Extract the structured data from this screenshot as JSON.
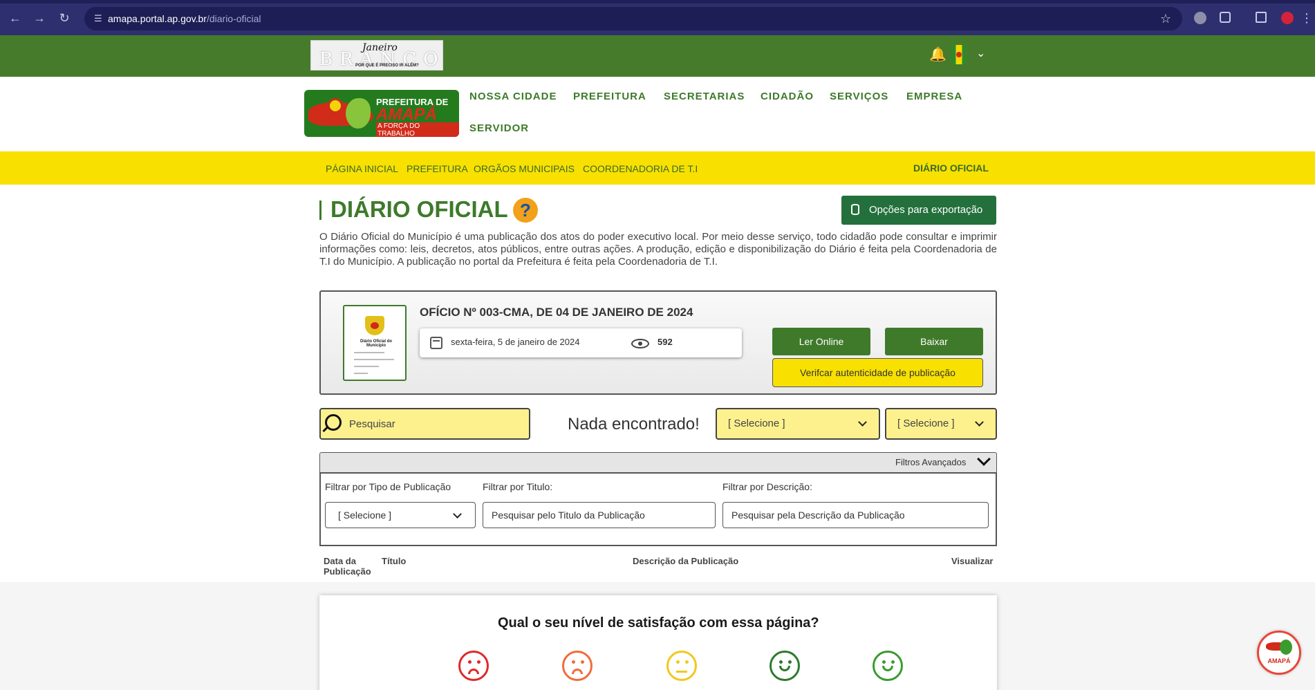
{
  "browser": {
    "url_host": "amapa.portal.ap.gov.br",
    "url_path": "/diario-oficial"
  },
  "brand": {
    "word": "BRANCO",
    "signature": "Janeiro",
    "tagline": "POR QUE É PRECISO IR ALÉM?"
  },
  "city_logo": {
    "line1": "PREFEITURA DE",
    "line2": "AMAPÁ",
    "line3": "A FORÇA DO TRABALHO"
  },
  "main_menu": [
    "NOSSA CIDADE",
    "PREFEITURA",
    "SECRETARIAS",
    "CIDADÃO",
    "SERVIÇOS",
    "EMPRESA",
    "SERVIDOR"
  ],
  "breadcrumb": {
    "items": [
      "PÁGINA INICIAL",
      "PREFEITURA",
      "ORGÃOS MUNICIPAIS",
      "COORDENADORIA DE T.I"
    ],
    "current": "DIÁRIO OFICIAL"
  },
  "page": {
    "title": "DIÁRIO OFICIAL",
    "help_symbol": "?",
    "export_label": "Opções para exportação",
    "intro": "O Diário Oficial do Município é uma publicação dos atos do poder executivo local. Por meio desse serviço, todo cidadão pode consultar e imprimir informações como: leis, decretos, atos públicos, entre outras ações. A produção, edição e disponibilização do Diário é feita pela Coordenadoria de T.I do Município. A publicação no portal da Prefeitura é feita pela Coordenadoria de T.I."
  },
  "featured": {
    "thumb_title": "Diário Oficial do Município",
    "title": "OFÍCIO Nº 003-CMA, DE 04 DE JANEIRO DE 2024",
    "date": "sexta-feira, 5 de janeiro de 2024",
    "views": "592",
    "read_label": "Ler Online",
    "download_label": "Baixar",
    "verify_label": "Verifcar autenticidade de publicação"
  },
  "search": {
    "placeholder": "Pesquisar",
    "no_results": "Nada encontrado!",
    "select1": "[ Selecione ]",
    "select2": "[ Selecione ]"
  },
  "filters": {
    "toggle_label": "Filtros Avançados",
    "type_label": "Filtrar por Tipo de Publicação",
    "type_value": "[ Selecione ]",
    "title_label": "Filtrar por Titulo:",
    "title_placeholder": "Pesquisar pelo Titulo da Publicação",
    "desc_label": "Filtrar por Descrição:",
    "desc_placeholder": "Pesquisar pela Descrição da Publicação"
  },
  "table": {
    "col_date_line1": "Data da",
    "col_date_line2": "Publicação",
    "col_title": "Título",
    "col_desc": "Descrição da Publicação",
    "col_view": "Visualizar"
  },
  "survey": {
    "title": "Qual o seu nível de satisfação com essa página?",
    "faces": [
      {
        "name": "very-dissatisfied",
        "color": "#e0282b",
        "mood": "sad"
      },
      {
        "name": "dissatisfied",
        "color": "#f26b3a",
        "mood": "sad"
      },
      {
        "name": "neutral",
        "color": "#f2c81a",
        "mood": "flat"
      },
      {
        "name": "satisfied",
        "color": "#2d7a2d",
        "mood": "happy"
      },
      {
        "name": "very-satisfied",
        "color": "#3a9b2e",
        "mood": "happy"
      }
    ]
  },
  "float_badge": {
    "label": "AMAPÁ"
  },
  "colors": {
    "primary_green": "#3d7a2a",
    "accent_yellow": "#f8e000",
    "input_yellow": "#fdf18e"
  }
}
